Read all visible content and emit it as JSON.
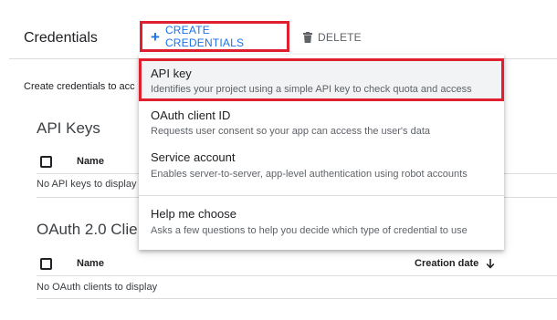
{
  "header": {
    "title": "Credentials",
    "create_label": "CREATE CREDENTIALS",
    "delete_label": "DELETE"
  },
  "content": {
    "intro": "Create credentials to acc",
    "api_keys": {
      "title": "API Keys",
      "col_name": "Name",
      "empty": "No API keys to display"
    },
    "oauth": {
      "title": "OAuth 2.0 Clie",
      "col_name": "Name",
      "col_creation_date": "Creation date",
      "empty": "No OAuth clients to display"
    }
  },
  "menu": {
    "items": [
      {
        "title": "API key",
        "desc": "Identifies your project using a simple API key to check quota and access"
      },
      {
        "title": "OAuth client ID",
        "desc": "Requests user consent so your app can access the user's data"
      },
      {
        "title": "Service account",
        "desc": "Enables server-to-server, app-level authentication using robot accounts"
      },
      {
        "title": "Help me choose",
        "desc": "Asks a few questions to help you decide which type of credential to use"
      }
    ]
  },
  "colors": {
    "accent": "#1a73e8",
    "highlight_border": "#e0202e",
    "muted_text": "#5f6368"
  },
  "icons": {
    "create": "plus-icon",
    "delete": "trash-icon",
    "sort": "arrow-down-icon"
  }
}
